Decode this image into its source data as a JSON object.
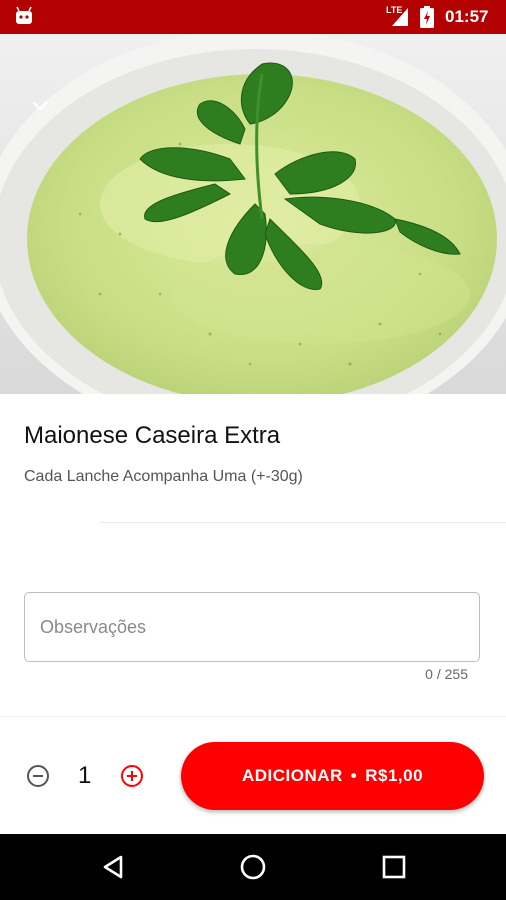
{
  "status_bar": {
    "network": "LTE",
    "time": "01:57",
    "icons": [
      "android-notification-icon",
      "signal-icon",
      "battery-icon"
    ]
  },
  "hero": {
    "image_description_icon": "mayonnaise-bowl-image"
  },
  "product": {
    "title": "Maionese Caseira Extra",
    "description": "Cada Lanche Acompanha Uma (+-30g)"
  },
  "notes": {
    "placeholder": "Observações",
    "value": "",
    "counter": "0 / 255"
  },
  "order": {
    "quantity": "1",
    "add_label": "ADICIONAR",
    "separator": "•",
    "price": "R$1,00"
  },
  "colors": {
    "status_bar": "#b30000",
    "accent": "#ff0000",
    "nav_bar": "#000000"
  }
}
